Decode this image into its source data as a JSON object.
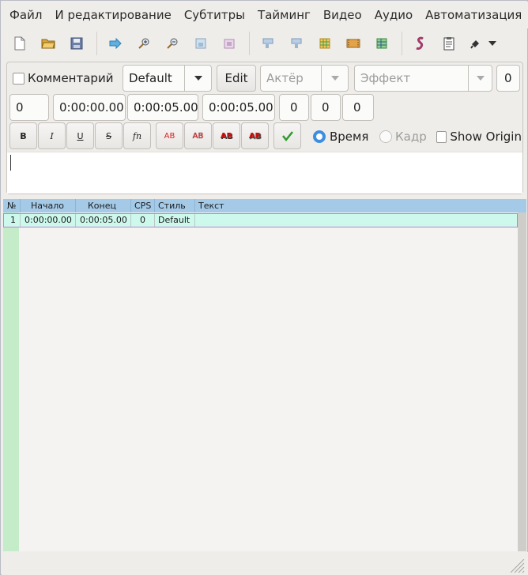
{
  "menubar": {
    "items": [
      "Файл",
      "И редактирование",
      "Субтитры",
      "Тайминг",
      "Видео",
      "Аудио",
      "Автоматизация"
    ]
  },
  "toolbar": {
    "icons": [
      "new-file-icon",
      "open-folder-icon",
      "save-icon",
      "jump-to-icon",
      "zoom-in-icon",
      "zoom-out-icon",
      "snapshot-icon",
      "snapshot-copy-icon",
      "shift-times-icon",
      "shift-up-icon",
      "sort-icon",
      "video-details-icon",
      "spell-check-icon",
      "styles-icon",
      "properties-icon",
      "tools-dropdown-icon"
    ]
  },
  "editor": {
    "comment_label": "Комментарий",
    "style_value": "Default",
    "edit_label": "Edit",
    "actor_placeholder": "Актёр",
    "effect_placeholder": "Эффект",
    "margin_value": "0",
    "layer_value": "0",
    "start_time": "0:00:00.00",
    "end_time": "0:00:05.00",
    "duration": "0:00:05.00",
    "margin_l": "0",
    "margin_r": "0",
    "margin_v": "0",
    "format_buttons": {
      "bold": "B",
      "italic": "I",
      "underline": "U",
      "strike": "S",
      "font": "fn",
      "color1": "AB",
      "color2": "AB",
      "color3": "AB",
      "color4": "AB"
    },
    "time_label": "Время",
    "frame_label": "Кадр",
    "show_original_label": "Show Origin",
    "text_value": ""
  },
  "grid": {
    "headers": {
      "num": "№",
      "start": "Начало",
      "end": "Конец",
      "cps": "CPS",
      "style": "Стиль",
      "text": "Текст"
    },
    "rows": [
      {
        "num": "1",
        "start": "0:00:00.00",
        "end": "0:00:05.00",
        "cps": "0",
        "style": "Default",
        "text": ""
      }
    ]
  },
  "colors": {
    "header_blue": "#a4cae8",
    "row_selected": "#cdf9ec",
    "row_border": "#c77ad1",
    "row_strip": "#c5ecc9",
    "radio_selected": "#3d8ee0"
  }
}
